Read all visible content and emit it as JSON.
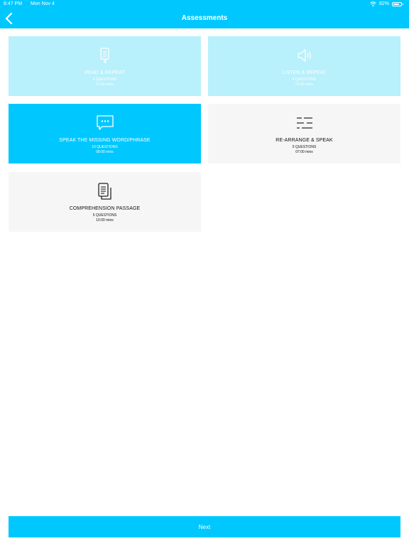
{
  "status": {
    "time": "8:47 PM",
    "date": "Mon Nov 4",
    "battery": "82%",
    "battery_level": 0.82
  },
  "header": {
    "title": "Assessments"
  },
  "cards": [
    {
      "title": "READ & REPEAT",
      "questions": "4 QUESTIONS",
      "duration": "01:00 mins",
      "icon": "document-icon"
    },
    {
      "title": "LISTEN & REPEAT",
      "questions": "4 QUESTIONS",
      "duration": "01:00 mins",
      "icon": "speaker-icon"
    },
    {
      "title": "SPEAK THE MISSING WORD/PHRASE",
      "questions": "10 QUESTIONS",
      "duration": "08:00 mins",
      "icon": "chat-bubble-icon"
    },
    {
      "title": "RE-ARRANGE & SPEAK",
      "questions": "5 QUESTIONS",
      "duration": "07:00 mins",
      "icon": "rearrange-lines-icon"
    },
    {
      "title": "COMPREHENSION PASSAGE",
      "questions": "5 QUESTIONS",
      "duration": "10:00 mins",
      "icon": "passage-icon"
    }
  ],
  "footer": {
    "next_label": "Next"
  },
  "colors": {
    "accent": "#00c8ff",
    "disabled": "#b8f0fc",
    "card_neutral": "#f6f6f6"
  }
}
